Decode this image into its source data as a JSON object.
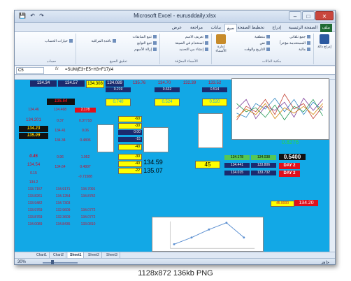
{
  "window": {
    "title": "Microsoft Excel - eurusddaily.xlsx",
    "minimize": "–",
    "maximize": "□",
    "close": "✕",
    "qat": [
      "💾",
      "↶",
      "↷"
    ]
  },
  "ribbon_tabs": [
    "ملف",
    "الصفحة الرئيسية",
    "إدراج",
    "تخطيط الصفحة",
    "صيغ",
    "بيانات",
    "مراجعة",
    "عرض"
  ],
  "ribbon": {
    "groups": [
      {
        "label": "مكتبة الدالات",
        "items": [
          "جمع تلقائي",
          "المستخدمة مؤخراً",
          "مالية",
          "منطقية",
          "نص",
          "التاريخ والوقت"
        ]
      },
      {
        "label": "الأسماء المعرّفة",
        "items": [
          "تعريف الاسم",
          "استخدام في الصيغة",
          "إنشاء من التحديد"
        ]
      },
      {
        "label": "تدقيق الصيغ",
        "items": [
          "تتبع السابقات",
          "تتبع التوابع",
          "إزالة الأسهم"
        ]
      },
      {
        "label": "حساب",
        "items": [
          "خيارات الحساب"
        ]
      }
    ],
    "insert_function": "إدراج دالة",
    "name_manager": "إدارة الأسماء",
    "watch_window": "نافذة المراقبة"
  },
  "formula_bar": {
    "name_box": "C5",
    "fx": "fx",
    "formula": "=SUM(E3+E5+H3+F17)/4"
  },
  "cells": {
    "r1": [
      "134.34",
      "134.57",
      "134.308",
      "134.089",
      "135.76",
      "134.70",
      "132.39",
      "133.52"
    ],
    "r2": [
      "0.219",
      "0.632",
      "0.514"
    ],
    "r3": [
      "135.54",
      "0.740",
      "0.524",
      "0.520"
    ],
    "left_a": [
      "134.46",
      "134.201",
      "134.23",
      "135.09",
      "0.45",
      "134.54",
      "0.15",
      "134.2"
    ],
    "left_b": [
      "134.468",
      "0.37",
      "134.41",
      "134.34",
      "0.96",
      "134.64"
    ],
    "left_c": [
      "2.178",
      "0.37718",
      "0.06",
      "0.4806",
      "1.052",
      "0.4807",
      "-0.71588"
    ],
    "left_list": [
      "133.7157",
      "133.8261",
      "133.9482",
      "133.9769",
      "133.8769",
      "134.0089"
    ],
    "mid_list": [
      "134.9171",
      "134.1254",
      "134.7303",
      "132.9609",
      "132.3609",
      "134.8435"
    ],
    "right_list": [
      "134.7091",
      "134.8782",
      "",
      "134.0772",
      "134.0772",
      "133.0810"
    ],
    "yellow_col": [
      "-60",
      "-30",
      "0.00",
      "-15",
      "-40",
      "-30",
      "-40",
      "-22"
    ],
    "big_a": "134.59",
    "big_b": "135.07",
    "r_45": "45",
    "r_vals": [
      "134.178",
      "134.038",
      "134.441",
      "133.806",
      "134.015",
      "133.732"
    ],
    "badge_val": "0.5400",
    "day": [
      "DAY 2",
      "DAY 2"
    ],
    "green_top": "0.8276",
    "bottom_pair": [
      "45.0000",
      "134.20"
    ]
  },
  "sheet_tabs": [
    "Chart1",
    "Chart2",
    "Sheet1",
    "Sheet2",
    "Sheet3"
  ],
  "active_sheet": "Sheet1",
  "status": {
    "zoom": "30%",
    "ready": "جاهز"
  },
  "caption": "1128x872  136kb  PNG",
  "colors": {
    "grid_bg": "#12a8e6",
    "accent_red": "#e0101c",
    "navy": "#1c2a6e",
    "yellow": "#ffff00",
    "green": "#55c755"
  }
}
